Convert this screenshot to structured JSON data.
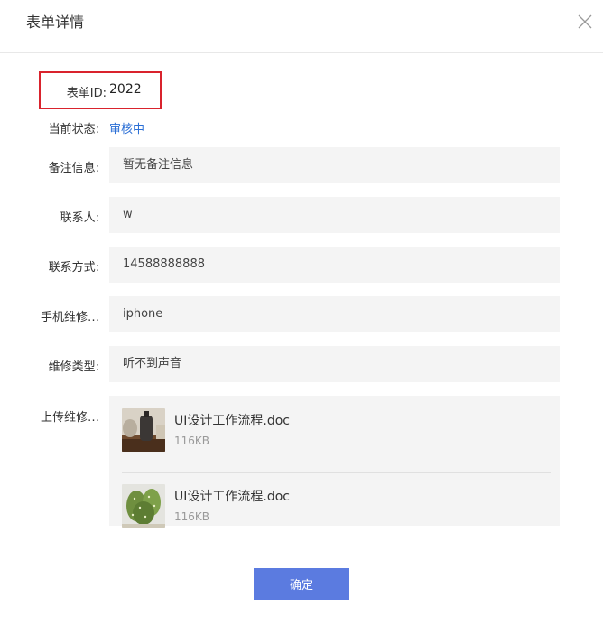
{
  "dialog": {
    "title": "表单详情"
  },
  "form": {
    "id_label": "表单ID:",
    "id_value": "2022",
    "status_label": "当前状态:",
    "status_value": "审核中",
    "remark_label": "备注信息:",
    "remark_value": "暂无备注信息",
    "contact_label": "联系人:",
    "contact_value": "w",
    "phone_label": "联系方式:",
    "phone_value": "14588888888",
    "device_label": "手机维修…",
    "device_value": "iphone",
    "repair_type_label": "维修类型:",
    "repair_type_value": "听不到声音",
    "upload_label": "上传维修…"
  },
  "files": [
    {
      "name": "UI设计工作流程.doc",
      "size": "116KB"
    },
    {
      "name": "UI设计工作流程.doc",
      "size": "116KB"
    }
  ],
  "footer": {
    "confirm_label": "确定"
  },
  "colors": {
    "accent": "#5b7be0",
    "status": "#2b6fd6",
    "highlight": "#d9232d"
  }
}
